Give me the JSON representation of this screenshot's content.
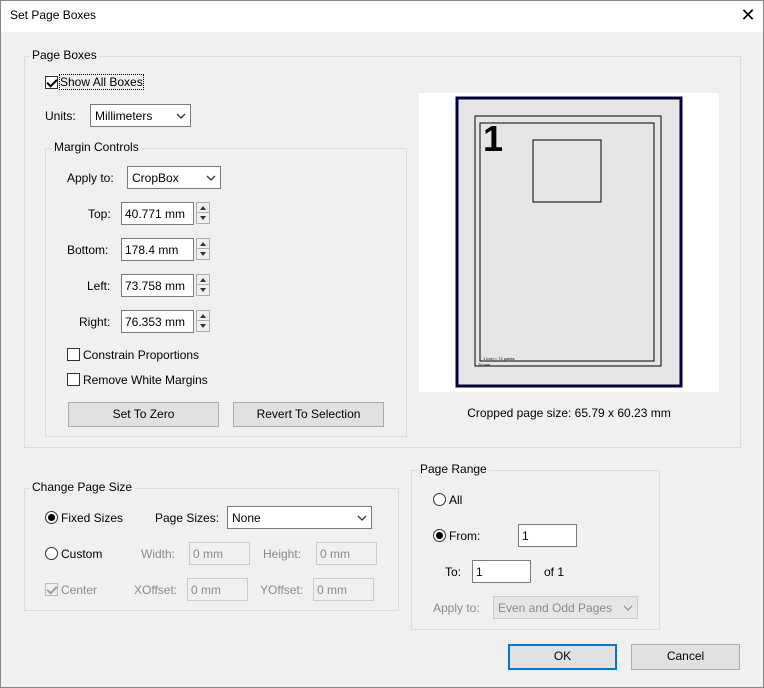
{
  "window": {
    "title": "Set Page Boxes",
    "close_symbol": "✕"
  },
  "page_boxes": {
    "legend": "Page Boxes",
    "show_all_boxes": {
      "label": "Show All Boxes",
      "checked": true
    },
    "units": {
      "label": "Units:",
      "value": "Millimeters"
    },
    "margin_controls": {
      "legend": "Margin Controls",
      "apply_to": {
        "label": "Apply to:",
        "value": "CropBox"
      },
      "top": {
        "label": "Top:",
        "value": "40.771 mm"
      },
      "bottom": {
        "label": "Bottom:",
        "value": "178.4 mm"
      },
      "left": {
        "label": "Left:",
        "value": "73.758 mm"
      },
      "right": {
        "label": "Right:",
        "value": "76.353 mm"
      },
      "constrain_proportions": {
        "label": "Constrain Proportions",
        "checked": false
      },
      "remove_white_margins": {
        "label": "Remove White Margins",
        "checked": false
      },
      "set_to_zero": "Set To Zero",
      "revert_to_selection": "Revert To Selection"
    },
    "preview": {
      "page_number": "1",
      "fine_print_1": "1 inch = 72 points",
      "fine_print_2": "20 mm",
      "cropped_size": "Cropped page size: 65.79 x 60.23 mm"
    }
  },
  "change_page_size": {
    "legend": "Change Page Size",
    "fixed_sizes": {
      "label": "Fixed Sizes",
      "selected": true
    },
    "page_sizes": {
      "label": "Page Sizes:",
      "value": "None"
    },
    "custom": {
      "label": "Custom",
      "selected": false
    },
    "width": {
      "label": "Width:",
      "value": "0 mm"
    },
    "height": {
      "label": "Height:",
      "value": "0 mm"
    },
    "center": {
      "label": "Center",
      "checked": true,
      "enabled": false
    },
    "xoffset": {
      "label": "XOffset:",
      "value": "0 mm"
    },
    "yoffset": {
      "label": "YOffset:",
      "value": "0 mm"
    }
  },
  "page_range": {
    "legend": "Page Range",
    "all": {
      "label": "All",
      "selected": false
    },
    "from": {
      "label": "From:",
      "value": "1",
      "selected": true
    },
    "to": {
      "label": "To:",
      "value": "1"
    },
    "of": "of 1",
    "apply_to": {
      "label": "Apply to:",
      "value": "Even and Odd Pages"
    }
  },
  "buttons": {
    "ok": "OK",
    "cancel": "Cancel"
  },
  "colors": {
    "accent": "#0078d7",
    "page_border": "#000040",
    "page_fill": "#e6e6e6"
  }
}
